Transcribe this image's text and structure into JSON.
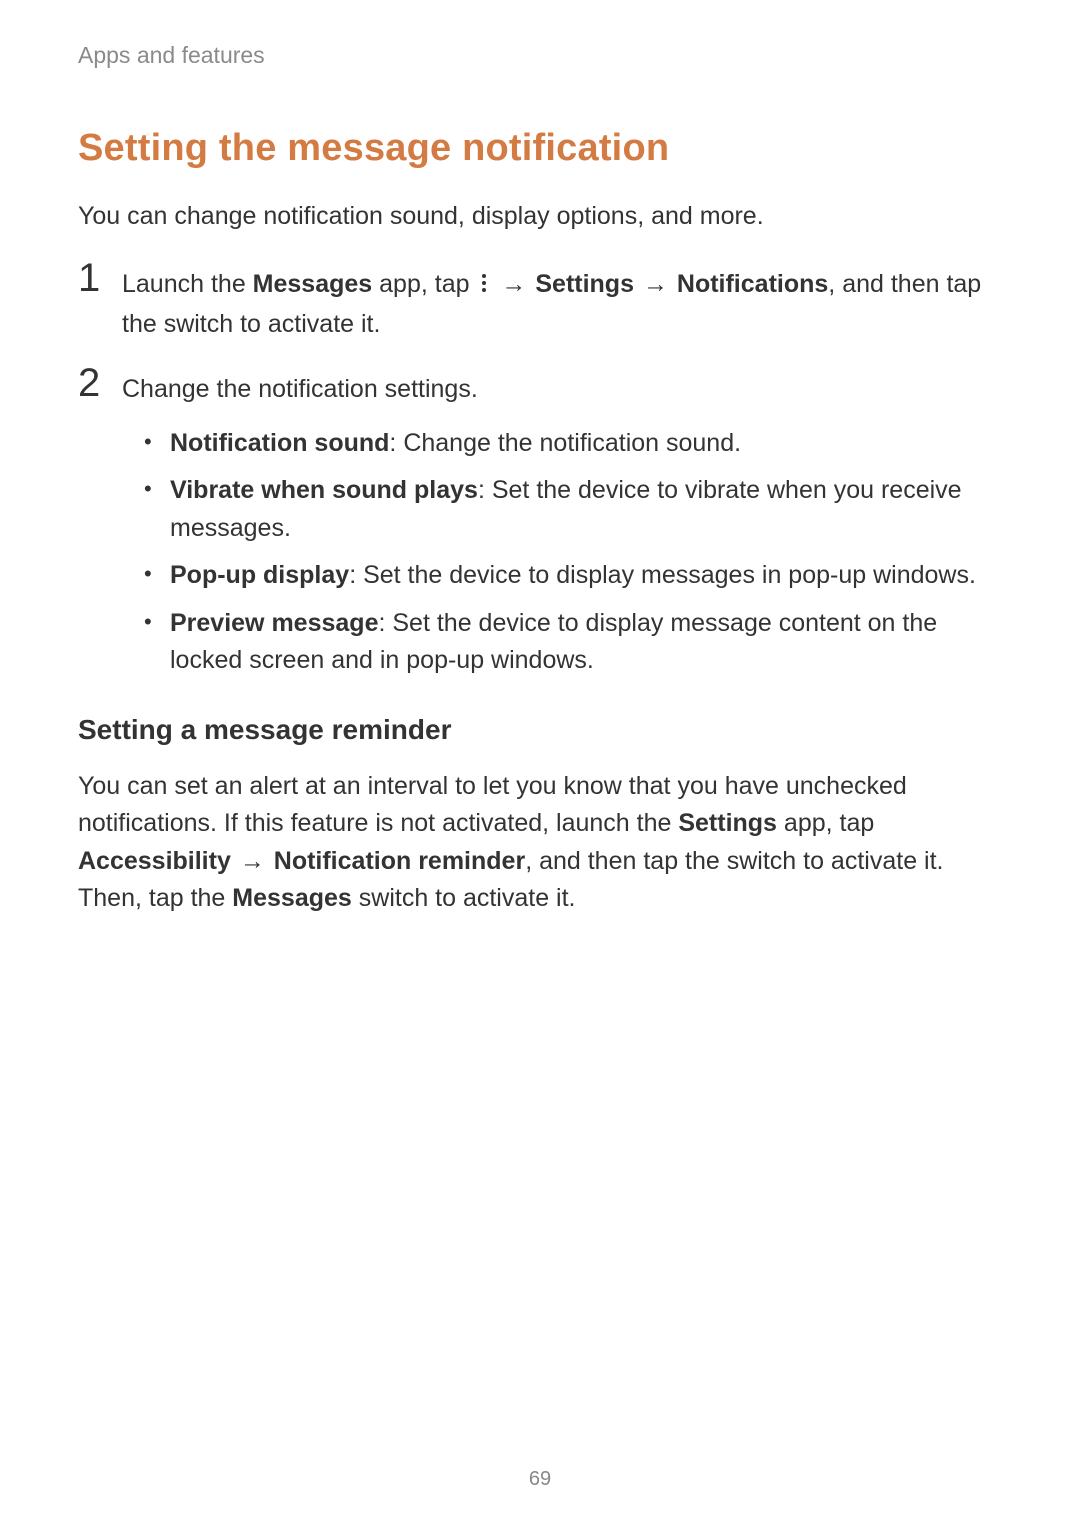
{
  "header": {
    "breadcrumb": "Apps and features"
  },
  "section": {
    "title": "Setting the message notification",
    "intro": "You can change notification sound, display options, and more."
  },
  "steps": {
    "s1": {
      "prefix": "Launch the ",
      "app_name": "Messages",
      "mid1": " app, tap ",
      "icon_name": "more-options-icon",
      "arrow1": "→",
      "settings_label": "Settings",
      "arrow2": "→",
      "notifications_label": "Notifications",
      "suffix": ", and then tap the switch to activate it."
    },
    "s2": {
      "text": "Change the notification settings.",
      "bullets": [
        {
          "label": "Notification sound",
          "desc": ": Change the notification sound."
        },
        {
          "label": "Vibrate when sound plays",
          "desc": ": Set the device to vibrate when you receive messages."
        },
        {
          "label": "Pop-up display",
          "desc": ": Set the device to display messages in pop-up windows."
        },
        {
          "label": "Preview message",
          "desc": ": Set the device to display message content on the locked screen and in pop-up windows."
        }
      ]
    }
  },
  "sub": {
    "title": "Setting a message reminder",
    "para_prefix": "You can set an alert at an interval to let you know that you have unchecked notifications. If this feature is not activated, launch the ",
    "settings_app": "Settings",
    "mid1": " app, tap ",
    "accessibility_label": "Accessibility",
    "arrow": "→",
    "notif_reminder": "Notification reminder",
    "mid2": ", and then tap the switch to activate it. Then, tap the ",
    "messages_label": "Messages",
    "suffix": " switch to activate it."
  },
  "footer": {
    "page_number": "69"
  }
}
